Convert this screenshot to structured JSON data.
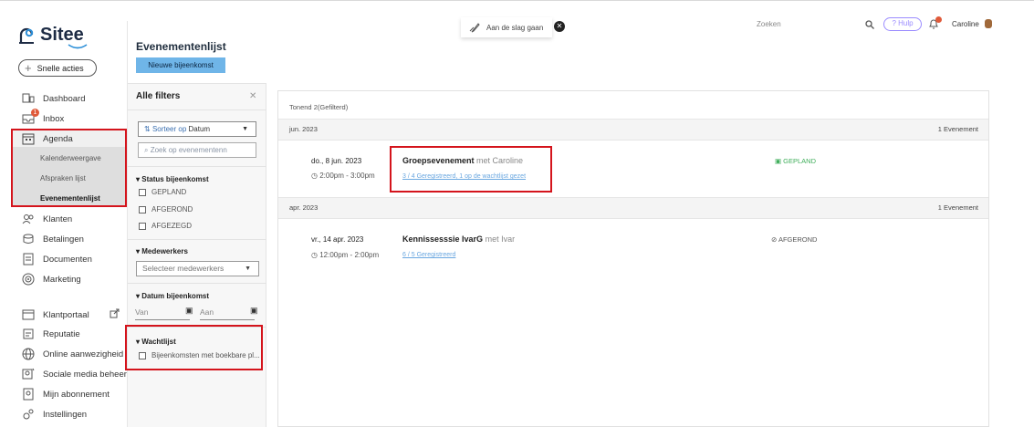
{
  "sidebar": {
    "logo": "Sitee",
    "quick_actions": "Snelle acties",
    "inbox_badge": "1",
    "items": [
      {
        "label": "Dashboard"
      },
      {
        "label": "Inbox"
      },
      {
        "label": "Agenda"
      },
      {
        "label": "Klanten"
      },
      {
        "label": "Betalingen"
      },
      {
        "label": "Documenten"
      },
      {
        "label": "Marketing"
      },
      {
        "label": "Klantportaal"
      },
      {
        "label": "Reputatie"
      },
      {
        "label": "Online aanwezigheid"
      },
      {
        "label": "Sociale media beheer"
      },
      {
        "label": "Mijn abonnement"
      },
      {
        "label": "Instellingen"
      }
    ],
    "agenda_sub": [
      "Kalenderweergave",
      "Afspraken lijst",
      "Evenementenlijst"
    ]
  },
  "header": {
    "onboarding": "Aan de slag gaan",
    "search_placeholder": "Zoeken",
    "help": "? Hulp",
    "user": "Caroline",
    "page_title": "Evenementenlijst",
    "new_button": "Nieuwe bijeenkomst"
  },
  "filters": {
    "title": "Alle filters",
    "sort_prefix": "Sorteer op",
    "sort_value": "Datum",
    "search_placeholder": "Zoek op evenementenn",
    "status_title": "Status bijeenkomst",
    "statuses": [
      "GEPLAND",
      "AFGEROND",
      "AFGEZEGD"
    ],
    "employees_title": "Medewerkers",
    "employees_placeholder": "Selecteer medewerkers",
    "date_title": "Datum bijeenkomst",
    "date_from": "Van",
    "date_to": "Aan",
    "waitlist_title": "Wachtlijst",
    "waitlist_option": "Bijeenkomsten met boekbare pl..."
  },
  "main": {
    "count": "Tonend 2(Gefilterd)",
    "groups": [
      {
        "month": "jun. 2023",
        "count": "1 Evenement",
        "event": {
          "date": "do., 8 jun. 2023",
          "time": "2:00pm - 3:00pm",
          "name": "Groepsevenement",
          "with": "met Caroline",
          "registration": "3 / 4 Geregistreerd, 1 op de wachtlijst gezet",
          "status": "GEPLAND",
          "status_color": "#3fae5b"
        }
      },
      {
        "month": "apr. 2023",
        "count": "1 Evenement",
        "event": {
          "date": "vr., 14 apr. 2023",
          "time": "12:00pm - 2:00pm",
          "name": "Kennissesssie IvarG",
          "with": "met Ivar",
          "registration": "6 / 5 Geregistreerd",
          "status": "AFGEROND",
          "status_color": "#555555"
        }
      }
    ]
  },
  "colors": {
    "accent": "#6fb5e8",
    "highlight": "#d4141c"
  }
}
